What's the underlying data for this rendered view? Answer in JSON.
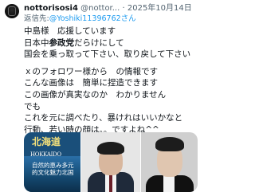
{
  "tweet": {
    "display_name": "nottorisosi4",
    "handle": "@nottor...",
    "separator": "·",
    "date": "2025年10月14日",
    "reply_prefix": "返信先:",
    "reply_mention": "@Yoshiki11396762さん",
    "body": {
      "line1": "中島様　応援しています",
      "line2_pre": "日本中",
      "line2_bold": "参政党",
      "line2_post": "だらけにして",
      "line3": "国会を乗っ取って下さい、取り戻して下さい",
      "line4": "ｘのフォロワー様から　の情報です",
      "line5": "こんな画像は　簡単に捏造できます",
      "line6": "この画像が真実なのか　わかりません",
      "line7": "でも",
      "line8": "これを元に調べたり、暴けれはいいかなと",
      "line9": "行動、若い時の顔は。。ですよね^^"
    }
  },
  "media": {
    "image1": {
      "title": "北海道",
      "subtitle": "HOKKAIDO",
      "vertical_text": "自然的恵み多元的文化魅力北国"
    },
    "image2": {
      "alt": "person-portrait"
    },
    "image3": {
      "alt": "person-portrait"
    }
  },
  "colors": {
    "text_primary": "#0f1419",
    "text_secondary": "#536471",
    "link": "#1d9bf0"
  }
}
